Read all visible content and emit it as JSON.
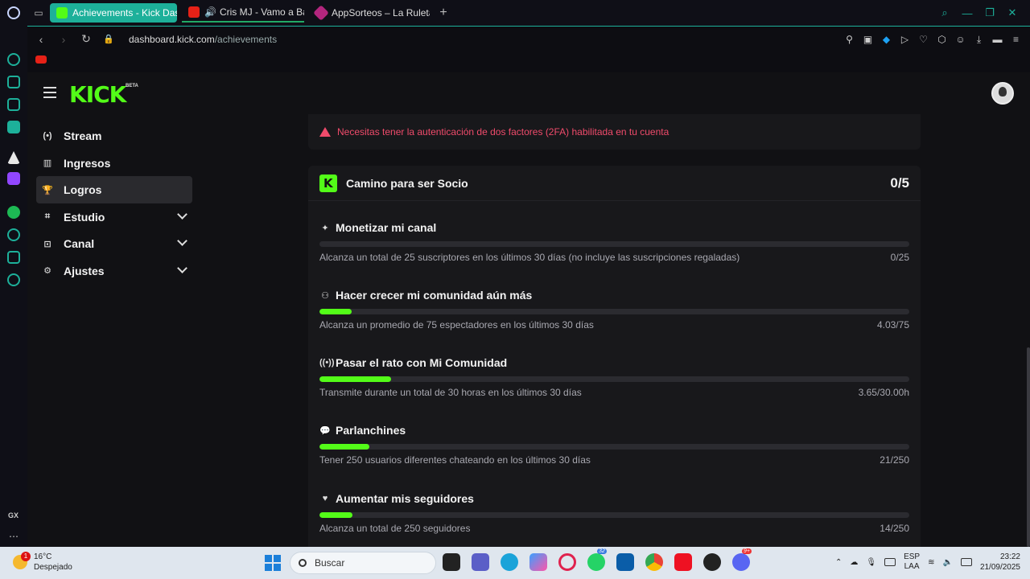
{
  "browser": {
    "tabs": [
      {
        "title": "Achievements - Kick Dashboard",
        "icon": "kick-favicon",
        "color": "#53fc18"
      },
      {
        "title": "Cris MJ - Vamo a Bailar",
        "icon": "youtube-favicon",
        "color": "#e62117"
      },
      {
        "title": "AppSorteos – La Ruleta de",
        "icon": "appsorteos-favicon",
        "color": "#b3267e"
      }
    ],
    "url_host": "dashboard.kick.com",
    "url_path": "/achievements"
  },
  "kick": {
    "beta": "BETA",
    "logo": "KICK",
    "nav": [
      {
        "label": "Stream",
        "icon": "stream-icon"
      },
      {
        "label": "Ingresos",
        "icon": "income-icon"
      },
      {
        "label": "Logros",
        "icon": "trophy-icon"
      },
      {
        "label": "Estudio",
        "icon": "studio-icon"
      },
      {
        "label": "Canal",
        "icon": "channel-icon"
      },
      {
        "label": "Ajustes",
        "icon": "gear-icon"
      }
    ],
    "alert": "Necesitas tener la autenticación de dos factores (2FA) habilitada en tu cuenta",
    "card": {
      "title": "Camino para ser Socio",
      "count": "0/5"
    },
    "goals": [
      {
        "title": "Monetizar mi canal",
        "icon": "sparkle-icon",
        "desc": "Alcanza un total de 25 suscriptores en los últimos 30 días (no incluye las suscripciones regaladas)",
        "value": "0/25",
        "progress": 0.0
      },
      {
        "title": "Hacer crecer mi comunidad aún más",
        "icon": "community-icon",
        "desc": "Alcanza un promedio de 75 espectadores en los últimos 30 días",
        "value": "4.03/75",
        "progress": 0.054
      },
      {
        "title": "Pasar el rato con Mi Comunidad",
        "icon": "broadcast-icon",
        "desc": "Transmite durante un total de 30 horas en los últimos 30 días",
        "value": "3.65/30.00h",
        "progress": 0.122
      },
      {
        "title": "Parlanchines",
        "icon": "chat-icon",
        "desc": "Tener 250 usuarios diferentes chateando en los últimos 30 días",
        "value": "21/250",
        "progress": 0.084
      },
      {
        "title": "Aumentar mis seguidores",
        "icon": "heart-icon",
        "desc": "Alcanza un total de 250 seguidores",
        "value": "14/250",
        "progress": 0.056
      }
    ]
  },
  "taskbar": {
    "temp": "16°C",
    "weather": "Despejado",
    "weather_badge": "1",
    "search": "Buscar",
    "whatsapp_badge": "32",
    "discord_badge": "9+",
    "lang1": "ESP",
    "lang2": "LAA",
    "time": "23:22",
    "date": "21/09/2025"
  },
  "colors": {
    "kick_green": "#53fc18",
    "alert_red": "#f04b6b",
    "opera_accent": "#1db09a"
  }
}
